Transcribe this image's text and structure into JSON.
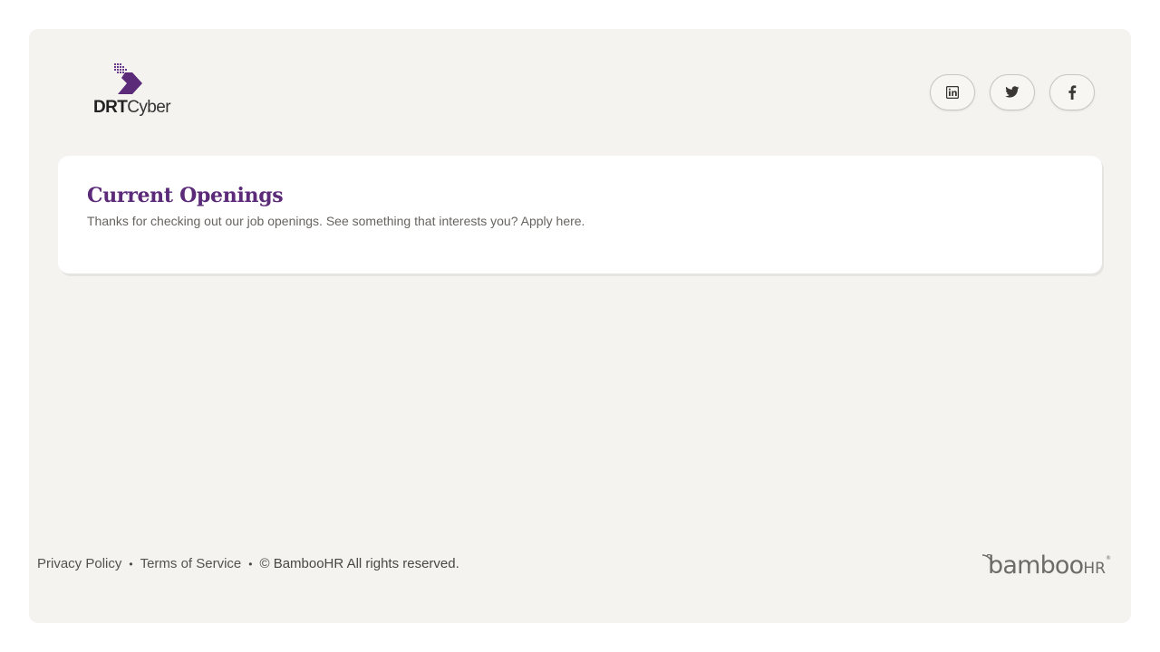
{
  "header": {
    "logo": {
      "text_bold": "DRT",
      "text_regular": "Cyber",
      "accent_color": "#5b2a78"
    },
    "social": [
      {
        "name": "linkedin",
        "icon": "linkedin-icon"
      },
      {
        "name": "twitter",
        "icon": "twitter-icon"
      },
      {
        "name": "facebook",
        "icon": "facebook-icon"
      }
    ]
  },
  "openings": {
    "title": "Current Openings",
    "subtitle": "Thanks for checking out our job openings. See something that interests you? Apply here."
  },
  "footer": {
    "privacy": "Privacy Policy",
    "terms": "Terms of Service",
    "copyright": "© BambooHR All rights reserved.",
    "separator": "•"
  },
  "branding": {
    "bamboo": "bamboo",
    "hr": "HR",
    "reg": "®"
  },
  "colors": {
    "page_bg": "#f4f3f0",
    "title": "#5b2a78",
    "card_bg": "#ffffff"
  }
}
